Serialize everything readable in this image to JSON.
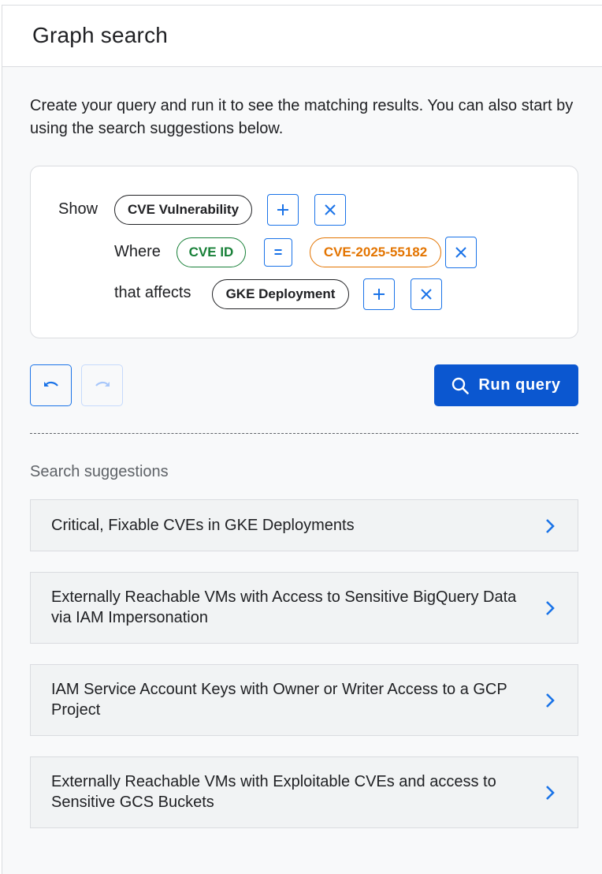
{
  "header": {
    "title": "Graph search"
  },
  "intro": "Create your query and run it to see the matching results. You can also start by using the search suggestions below.",
  "query": {
    "show_label": "Show",
    "show_chip": "CVE Vulnerability",
    "where_label": "Where",
    "where_field": "CVE ID",
    "where_operator": "=",
    "where_value": "CVE-2025-55182",
    "affects_label": "that affects",
    "affects_chip": "GKE Deployment"
  },
  "actions": {
    "run_label": "Run query"
  },
  "suggestions": {
    "title": "Search suggestions",
    "items": [
      {
        "label": "Critical, Fixable CVEs in GKE Deployments"
      },
      {
        "label": "Externally Reachable VMs with Access to Sensitive BigQuery Data via IAM Impersonation"
      },
      {
        "label": "IAM Service Account Keys with Owner or Writer Access to a GCP Project"
      },
      {
        "label": "Externally Reachable VMs with Exploitable CVEs and access to Sensitive GCS Buckets"
      }
    ]
  },
  "colors": {
    "accent": "#1a73e8",
    "primary_button": "#0b57d0",
    "green_chip": "#188038",
    "orange_chip": "#e37400"
  },
  "icons": [
    "plus-icon",
    "close-icon",
    "undo-icon",
    "redo-icon",
    "search-icon",
    "chevron-right-icon"
  ]
}
